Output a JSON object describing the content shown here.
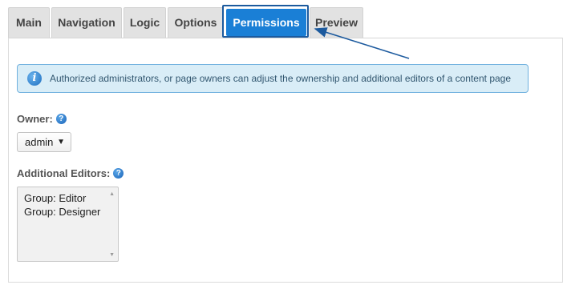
{
  "tabs": [
    {
      "label": "Main"
    },
    {
      "label": "Navigation"
    },
    {
      "label": "Logic"
    },
    {
      "label": "Options"
    },
    {
      "label": "Permissions",
      "active": true
    },
    {
      "label": "Preview"
    }
  ],
  "info": {
    "icon": "info-icon",
    "text": "Authorized administrators, or page owners can adjust the ownership and additional editors of a content page"
  },
  "owner": {
    "label": "Owner:",
    "help_icon": "question-icon",
    "selected": "admin"
  },
  "editors": {
    "label": "Additional Editors:",
    "help_icon": "question-icon",
    "items": [
      "Group: Editor",
      "Group: Designer"
    ]
  },
  "colors": {
    "accent": "#1a7fd6",
    "info_bg": "#d9edf7",
    "annotation": "#1c5a9e"
  }
}
